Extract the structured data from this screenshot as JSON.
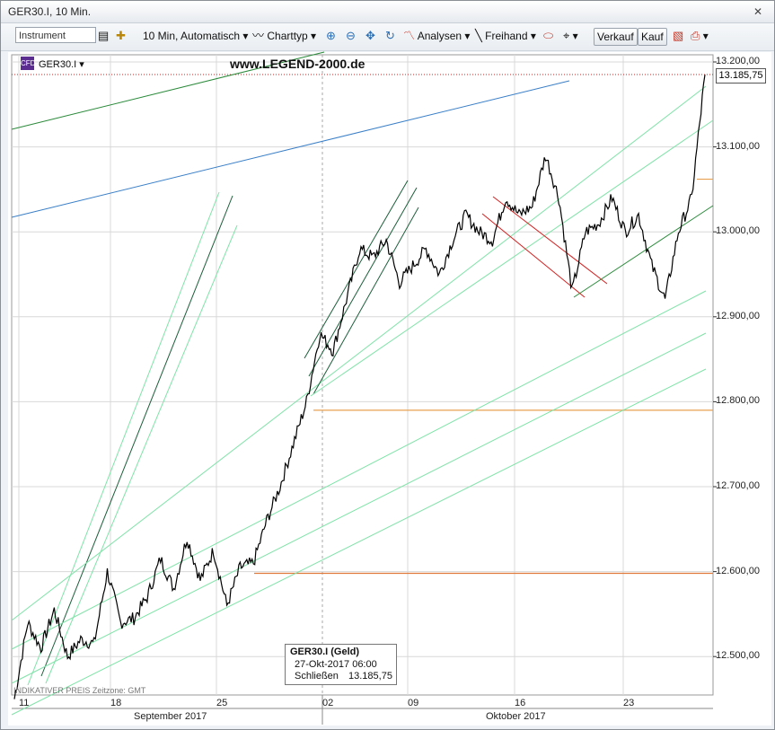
{
  "window": {
    "title": "GER30.I, 10 Min."
  },
  "toolbar": {
    "instrument_placeholder": "Instrument",
    "interval_label": "10 Min,",
    "scaling_label": "Automatisch",
    "charttype_label": "Charttyp",
    "analysen_label": "Analysen",
    "freihand_label": "Freihand",
    "verkauf_label": "Verkauf",
    "kauf_label": "Kauf"
  },
  "chart": {
    "instrument_label": "GER30.I",
    "watermark": "www.LEGEND-2000.de",
    "current_price_tag": "13.185,75",
    "footer_note": "INDIKATIVER PREIS   Zeitzone: GMT",
    "y_ticks": [
      "13.200,00",
      "13.100,00",
      "13.000,00",
      "12.900,00",
      "12.800,00",
      "12.700,00",
      "12.600,00",
      "12.500,00"
    ],
    "x_ticks": [
      "11",
      "18",
      "25",
      "02",
      "09",
      "16",
      "23"
    ],
    "months": [
      "September 2017",
      "Oktober 2017"
    ],
    "tooltip": {
      "title": "GER30.I (Geld)",
      "datetime": "27-Okt-2017 06:00",
      "close_label": "Schließen",
      "close_value": "13.185,75"
    },
    "colors": {
      "price_line": "#000000",
      "bright_channel": "#7fe3a8",
      "dark_channel": "#1c5e3a",
      "blue_line": "#3a7fc8",
      "red_channel": "#d42020",
      "orange_level": "#e8a050"
    }
  },
  "chart_data": {
    "type": "line",
    "title": "",
    "xlabel": "",
    "ylabel": "",
    "ylim": [
      12460,
      13230
    ],
    "x_categories": [
      "11",
      "18",
      "25",
      "02",
      "09",
      "16",
      "23"
    ],
    "series": [
      {
        "values": [
          12450,
          12540,
          12510,
          12555,
          12500,
          12520,
          12515,
          12600,
          12540,
          12545,
          12570,
          12615,
          12580,
          12640,
          12590,
          12625,
          12560,
          12605,
          12610,
          12660,
          12700,
          12750,
          12800,
          12880,
          12860,
          12920,
          12980,
          12970,
          12990,
          12940,
          12960,
          12980,
          12950,
          12990,
          13020,
          13000,
          12990,
          13040,
          13020,
          13030,
          13090,
          13040,
          12930,
          13000,
          13010,
          13040,
          13000,
          13020,
          12960,
          12920,
          13000,
          13040,
          13185
        ]
      }
    ],
    "horizontal_levels": [
      12790,
      12598,
      13062
    ]
  }
}
